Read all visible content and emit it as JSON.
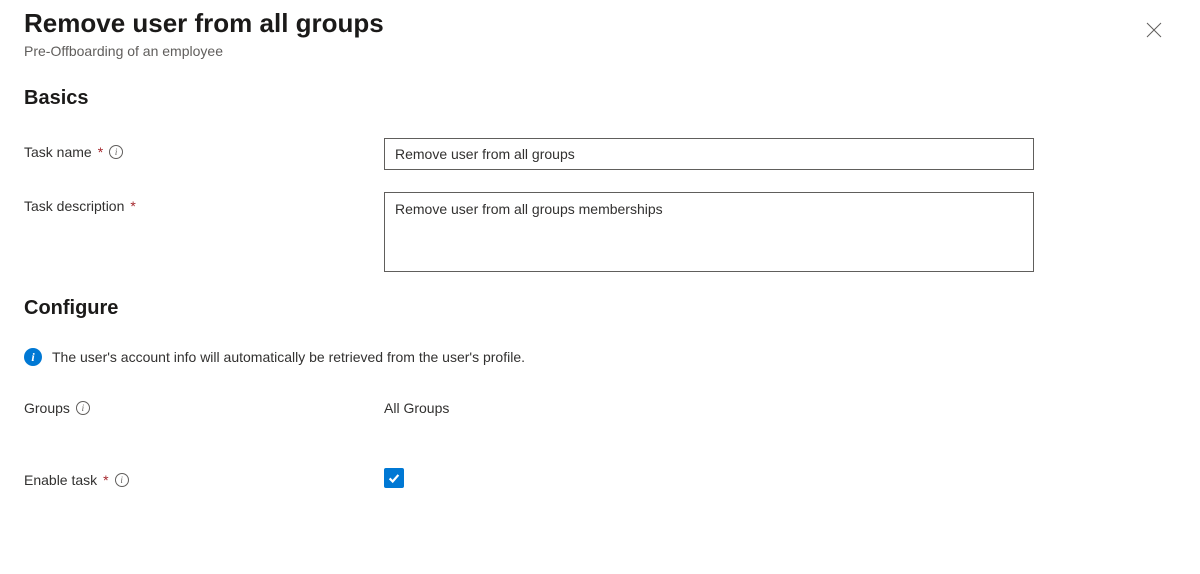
{
  "header": {
    "title": "Remove user from all groups",
    "subtitle": "Pre-Offboarding of an employee"
  },
  "basics": {
    "heading": "Basics",
    "task_name_label": "Task name",
    "task_name_value": "Remove user from all groups",
    "task_description_label": "Task description",
    "task_description_value": "Remove user from all groups memberships"
  },
  "configure": {
    "heading": "Configure",
    "info_text": "The user's account info will automatically be retrieved from the user's profile.",
    "groups_label": "Groups",
    "groups_value": "All Groups",
    "enable_task_label": "Enable task",
    "enable_task_checked": true
  }
}
